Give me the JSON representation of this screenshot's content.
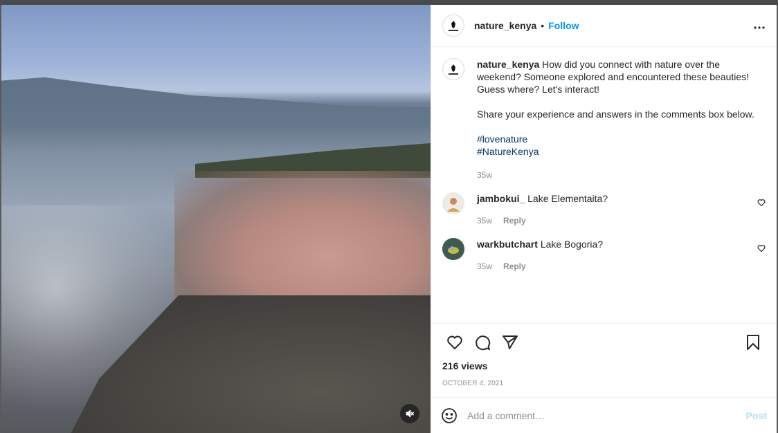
{
  "post": {
    "username": "nature_kenya",
    "separator": "•",
    "follow_label": "Follow",
    "more_label": "•••",
    "caption_line1": "How did you connect with nature over the",
    "caption_line2": "weekend? Someone explored and encountered these beauties!",
    "caption_line3": "Guess where? Let's interact!",
    "caption_line4": "Share your experience and answers in the comments box below.",
    "hashtags": [
      "#lovenature",
      "#NatureKenya"
    ],
    "caption_age": "35w",
    "views": "216 views",
    "date": "OCTOBER 4, 2021"
  },
  "comments": [
    {
      "username": "jambokui_",
      "text": "Lake Elementaita?",
      "age": "35w",
      "reply_label": "Reply"
    },
    {
      "username": "warkbutchart",
      "text": "Lake Bogoria?",
      "age": "35w",
      "reply_label": "Reply"
    }
  ],
  "comment_box": {
    "placeholder": "Add a comment…",
    "post_label": "Post"
  }
}
